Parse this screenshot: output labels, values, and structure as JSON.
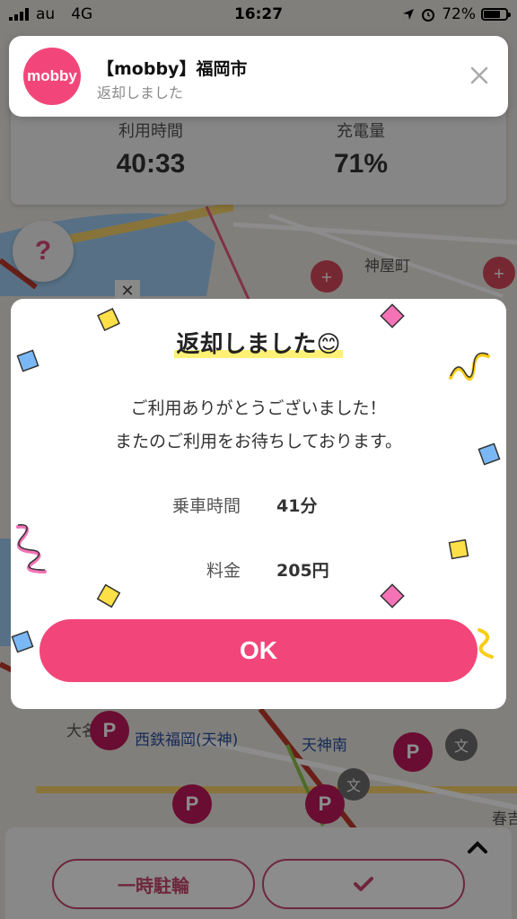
{
  "status_bar": {
    "carrier": "au",
    "network": "4G",
    "time": "16:27",
    "battery": "72%",
    "battery_level": 0.72
  },
  "notification": {
    "app_logo": "mobby",
    "title": "【mobby】福岡市",
    "body": "返却しました"
  },
  "stats": {
    "usage_time_label": "利用時間",
    "usage_time_value": "40:33",
    "charge_label": "充電量",
    "charge_value": "71%"
  },
  "help_button": {
    "label": "?"
  },
  "map": {
    "labels": [
      "神屋町",
      "西鉄福岡(天神)",
      "天神南",
      "大名",
      "春吉"
    ],
    "parking_icon": "P",
    "hospital_icon": "+",
    "text_icon": "文"
  },
  "modal": {
    "title": "返却しました",
    "title_emoji": "😊",
    "message_line1": "ご利用ありがとうございました！",
    "message_line2": "またのご利用をお待ちしております。",
    "ride_time_label": "乗車時間",
    "ride_time_value": "41分",
    "fee_label": "料金",
    "fee_value": "205円",
    "ok_label": "OK"
  },
  "bottom_bar": {
    "park_label": "一時駐輪",
    "check_icon": "check-icon",
    "expand_icon": "chevron-up-icon"
  },
  "colors": {
    "brand_pink": "#f2467a",
    "accent_magenta": "#c2185b"
  }
}
